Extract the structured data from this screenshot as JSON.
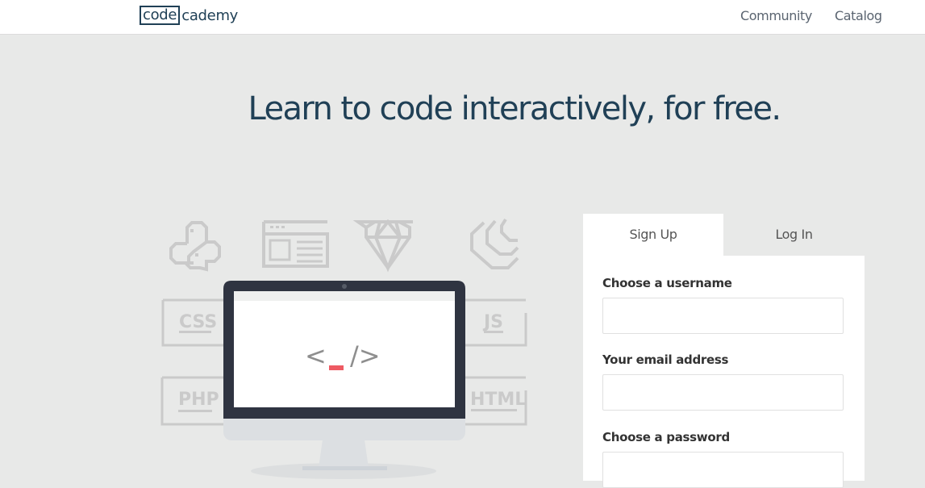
{
  "header": {
    "logo_box": "code",
    "logo_rest": "cademy",
    "nav": [
      {
        "label": "Community"
      },
      {
        "label": "Catalog"
      }
    ]
  },
  "hero": {
    "headline": "Learn to code interactively, for free."
  },
  "illustration": {
    "languages": [
      "CSS",
      "JS",
      "PHP",
      "HTML"
    ],
    "icons": [
      "python-icon",
      "browser-window-icon",
      "ruby-gem-icon",
      "jquery-icon"
    ],
    "screen_code": "< _/>",
    "cursor_color": "#ee5a63"
  },
  "auth_panel": {
    "tabs": [
      {
        "label": "Sign Up",
        "active": true
      },
      {
        "label": "Log In",
        "active": false
      }
    ],
    "fields": [
      {
        "label": "Choose a username",
        "value": "",
        "placeholder": ""
      },
      {
        "label": "Your email address",
        "value": "",
        "placeholder": ""
      },
      {
        "label": "Choose a password",
        "value": "",
        "placeholder": ""
      }
    ]
  },
  "colors": {
    "brand": "#204056",
    "background": "#e8e9e8",
    "monitor": "#2f3441"
  }
}
